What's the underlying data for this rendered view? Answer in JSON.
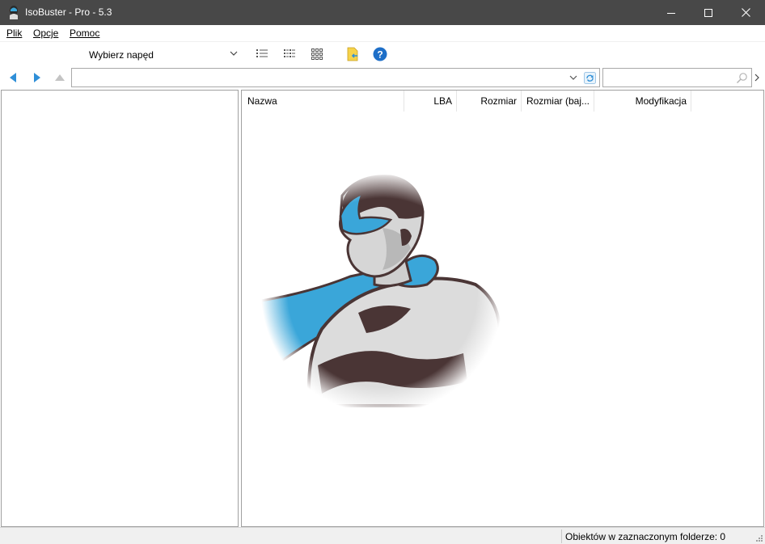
{
  "window": {
    "title": "IsoBuster - Pro - 5.3",
    "controls": [
      "minimize",
      "maximize",
      "close"
    ]
  },
  "menu": {
    "items": [
      "Plik",
      "Opcje",
      "Pomoc"
    ]
  },
  "toolbar": {
    "drive_select": "Wybierz napęd",
    "icons": [
      "list-view-icon",
      "detail-view-icon",
      "tile-view-icon",
      "extract-icon",
      "help-icon"
    ]
  },
  "address": {
    "path": "",
    "search": ""
  },
  "file_list": {
    "columns": [
      "Nazwa",
      "LBA",
      "Rozmiar",
      "Rozmiar (baj...",
      "Modyfikacja"
    ],
    "rows": []
  },
  "status": {
    "objects_text": "Obiektów w zaznaczonym folderze: 0"
  },
  "colors": {
    "titlebar": "#484848",
    "nav_blue": "#2f8fd8",
    "logo_blue": "#3aa6d9",
    "logo_dark": "#4a3535"
  }
}
